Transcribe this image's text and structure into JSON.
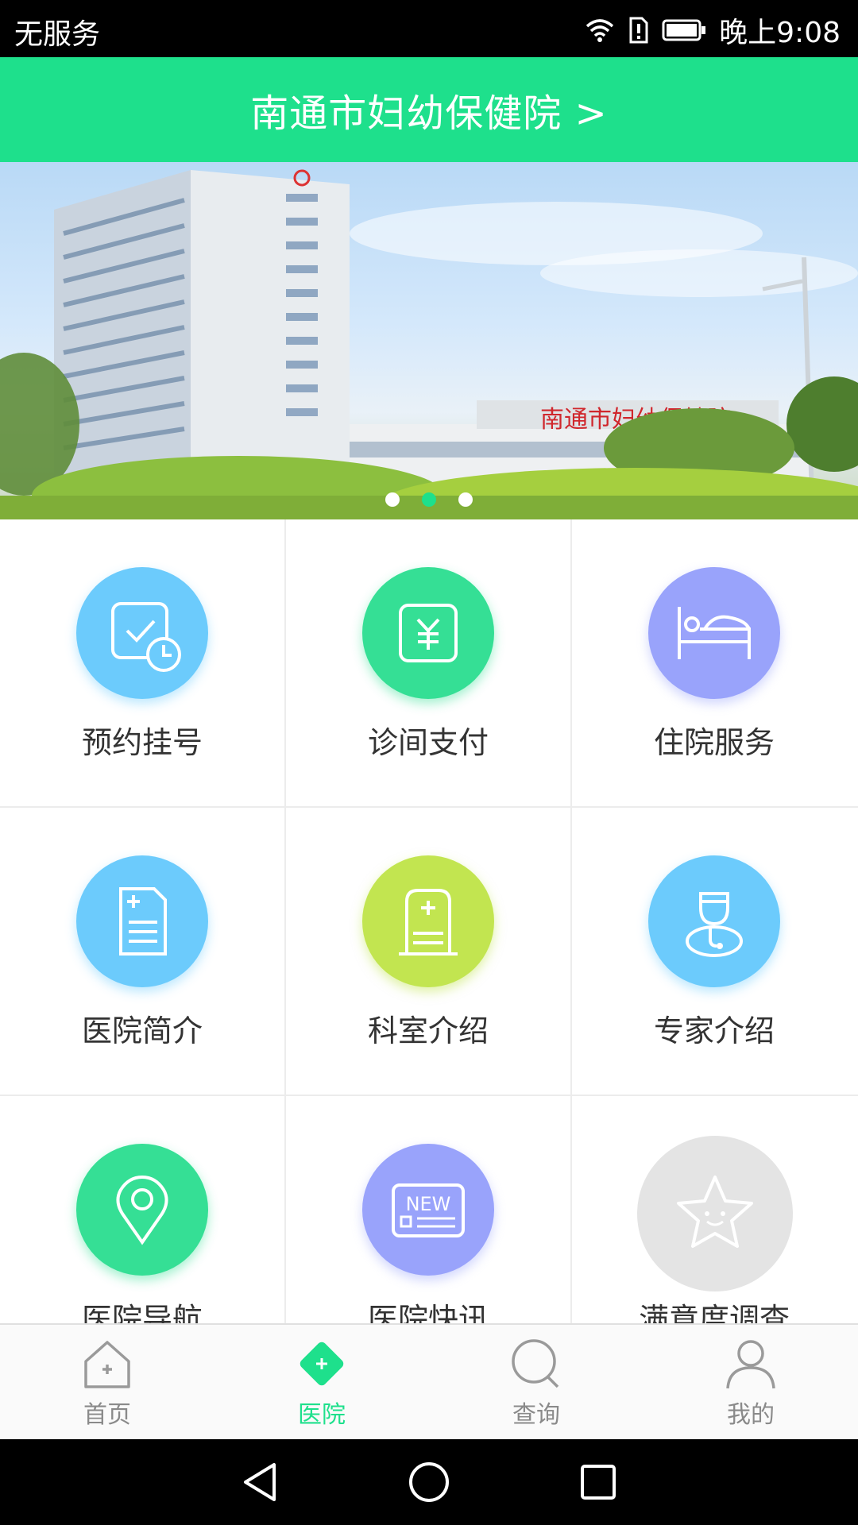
{
  "status_bar": {
    "carrier": "无服务",
    "time": "晚上9:08"
  },
  "header": {
    "title": "南通市妇幼保健院 >"
  },
  "banner": {
    "sign_text": "南通市妇幼保健院",
    "slides": 3,
    "active_slide": 2
  },
  "grid": {
    "items": [
      {
        "label": "预约挂号",
        "icon": "calendar-clock-icon",
        "color": "#6ccbfc"
      },
      {
        "label": "诊间支付",
        "icon": "yuan-payment-icon",
        "color": "#35df95"
      },
      {
        "label": "住院服务",
        "icon": "hospital-bed-icon",
        "color": "#99a3fb"
      },
      {
        "label": "医院简介",
        "icon": "document-plus-icon",
        "color": "#6ccbfc"
      },
      {
        "label": "科室介绍",
        "icon": "department-plus-icon",
        "color": "#c2e550"
      },
      {
        "label": "专家介绍",
        "icon": "doctor-icon",
        "color": "#6ccbfc"
      },
      {
        "label": "医院导航",
        "icon": "location-pin-icon",
        "color": "#35df95"
      },
      {
        "label": "医院快讯",
        "icon": "news-icon",
        "color": "#99a3fb",
        "badge": "NEW"
      },
      {
        "label": "满意度调查",
        "icon": "star-smile-icon",
        "color": "#e4e4e4"
      }
    ]
  },
  "bottom_nav": {
    "items": [
      {
        "label": "首页",
        "icon": "home-icon"
      },
      {
        "label": "医院",
        "icon": "hospital-diamond-icon",
        "active": true
      },
      {
        "label": "查询",
        "icon": "search-icon"
      },
      {
        "label": "我的",
        "icon": "user-icon"
      }
    ]
  },
  "colors": {
    "accent": "#1ee08c",
    "inactive": "#8a8a8a"
  }
}
